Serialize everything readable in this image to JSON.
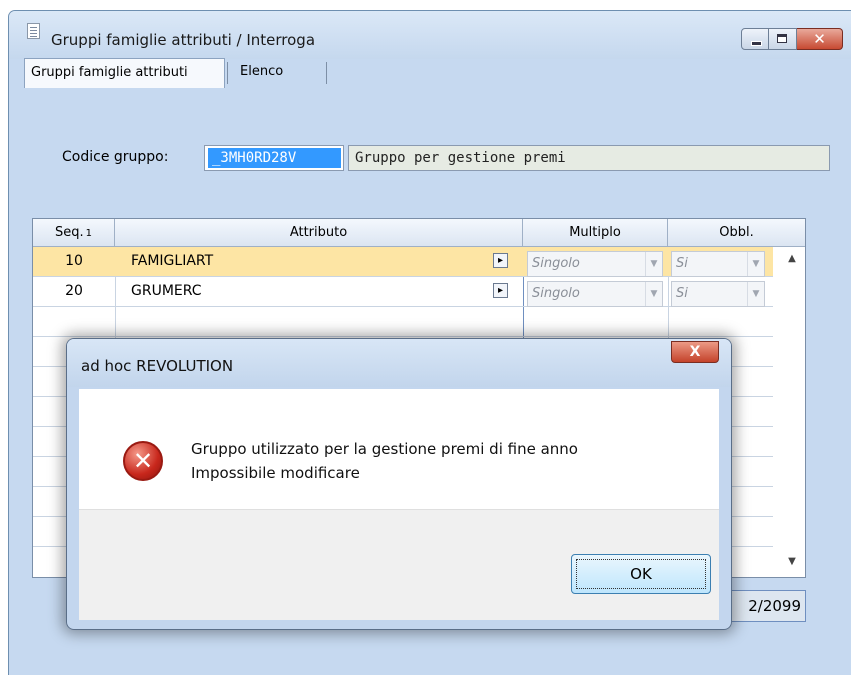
{
  "window": {
    "title": "Gruppi famiglie attributi / Interroga",
    "minimize_label": "",
    "close_label": "✕"
  },
  "tabs": [
    {
      "label": "Gruppi famiglie attributi"
    },
    {
      "label": "Elenco"
    }
  ],
  "form": {
    "code_label": "Codice gruppo:",
    "code_value": "_3MH0RD28V",
    "description_value": "Gruppo per gestione premi"
  },
  "grid": {
    "headers": {
      "seq": "Seq.",
      "seq_sort": "1",
      "attribute": "Attributo",
      "multiple": "Multiplo",
      "required": "Obbl."
    },
    "rows": [
      {
        "seq": "10",
        "attribute": "FAMIGLIART",
        "multiple": "Singolo",
        "required": "Si",
        "selected": true
      },
      {
        "seq": "20",
        "attribute": "GRUMERC",
        "multiple": "Singolo",
        "required": "Si",
        "selected": false
      }
    ],
    "zoom_glyph": "▸",
    "combo_arrow": "▼",
    "scroll_up": "▲",
    "scroll_down": "▼"
  },
  "date_field": {
    "value": "2/2099"
  },
  "dialog": {
    "title": "ad hoc REVOLUTION",
    "close_label": "X",
    "icon": "error-icon",
    "icon_glyph": "✕",
    "message_line1": "Gruppo utilizzato per la gestione premi di fine anno",
    "message_line2": "Impossibile modificare",
    "ok_label": "OK"
  },
  "colors": {
    "selected_row": "#fde5a4",
    "selection_highlight": "#3399ff",
    "window_bg": "#c6d9f0",
    "close_button": "#c74a32"
  }
}
